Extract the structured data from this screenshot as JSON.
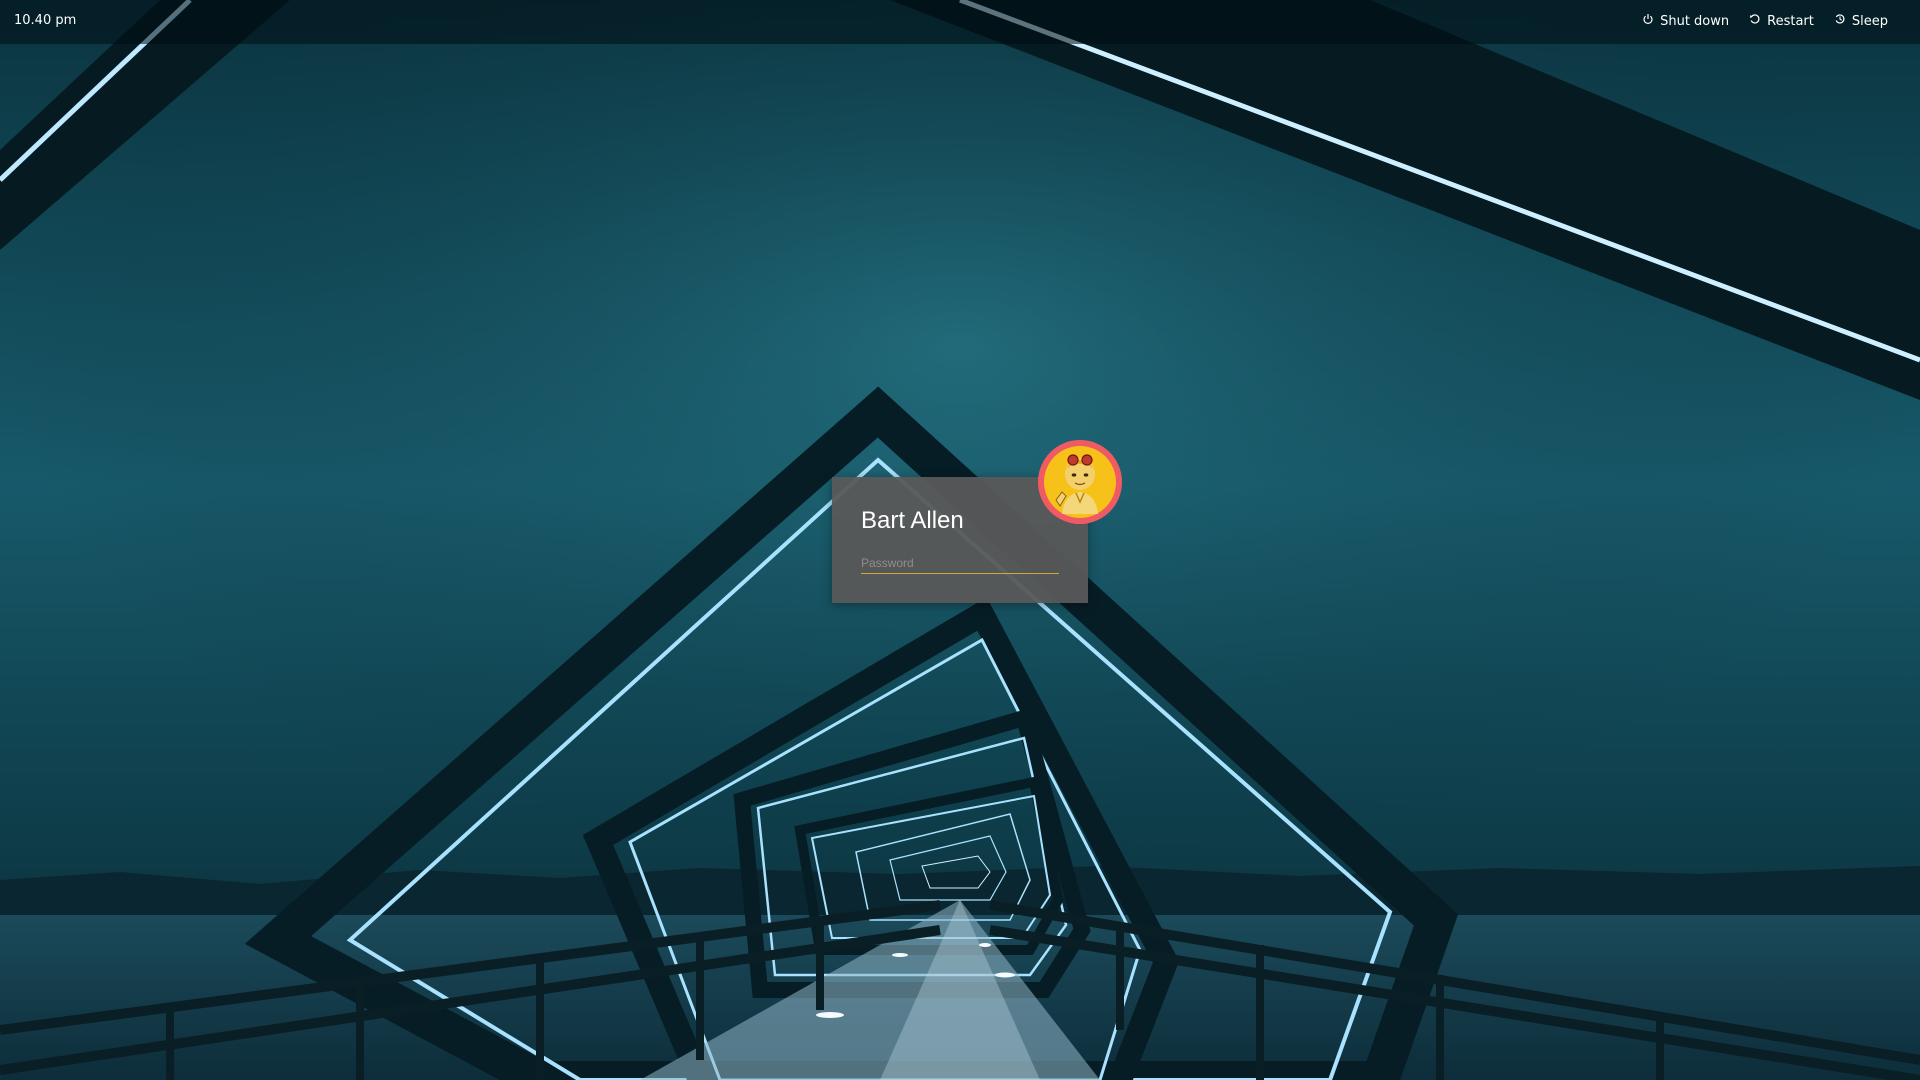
{
  "topbar": {
    "time": "10.40 pm",
    "actions": [
      {
        "label": "Shut down",
        "icon": "power-icon"
      },
      {
        "label": "Restart",
        "icon": "restart-icon"
      },
      {
        "label": "Sleep",
        "icon": "sleep-icon"
      }
    ]
  },
  "login": {
    "user_name": "Bart Allen",
    "password_placeholder": "Password",
    "password_value": ""
  },
  "colors": {
    "accent": "#d9a53a",
    "avatar_ring": "#f05a63",
    "card_bg": "#585858"
  }
}
